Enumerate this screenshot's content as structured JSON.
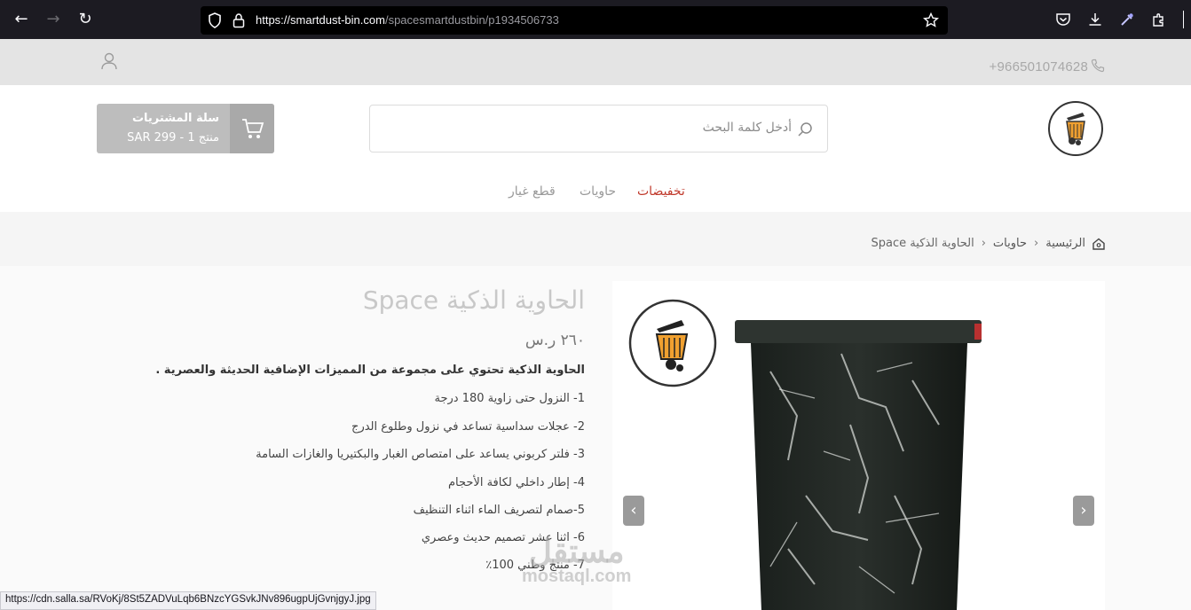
{
  "browser": {
    "url_host": "https://smartdust-bin.com",
    "url_path": "/spacesmartdustbin/p1934506733"
  },
  "topstrip": {
    "phone": "+966501074628"
  },
  "header": {
    "search_placeholder": "أدخل كلمة البحث",
    "cart_title": "سلة المشتريات",
    "cart_summary": "SAR 299 - 1 منتج"
  },
  "menu": {
    "item1": "تخفيضات",
    "item2": "حاويات",
    "item3": "قطع غيار"
  },
  "breadcrumb": {
    "home": "الرئيسية",
    "category": "حاويات",
    "current": "الحاوية الذكية Space"
  },
  "product": {
    "title": "الحاوية الذكية Space",
    "price": "٢٦٠ ر.س",
    "description": "الحاوية الذكية تحتوي على مجموعة من المميزات الإضافية الحديثة والعصرية .",
    "features": [
      "1- النزول حتى زاوية 180 درجة",
      "2- عجلات سداسية تساعد في نزول وطلوع الدرج",
      "3- فلتر كربوني يساعد على امتصاص الغبار والبكتيريا والغازات السامة",
      "4- إطار داخلي لكافة الأحجام",
      "5-صمام لتصريف الماء اثناء التنظيف",
      "6- اثنا عشر تصميم حديث وعصري",
      "7- منتج وطني 100٪"
    ]
  },
  "statusbar": {
    "link": "https://cdn.salla.sa/RVoKj/8St5ZADVuLqb6BNzcYGSvkJNv896ugpUjGvnjgyJ.jpg"
  },
  "watermark": {
    "arabic": "مستقل",
    "latin": "mostaql.com"
  },
  "colors": {
    "sale": "#c0392b",
    "browser_bg": "#1c1b22"
  }
}
